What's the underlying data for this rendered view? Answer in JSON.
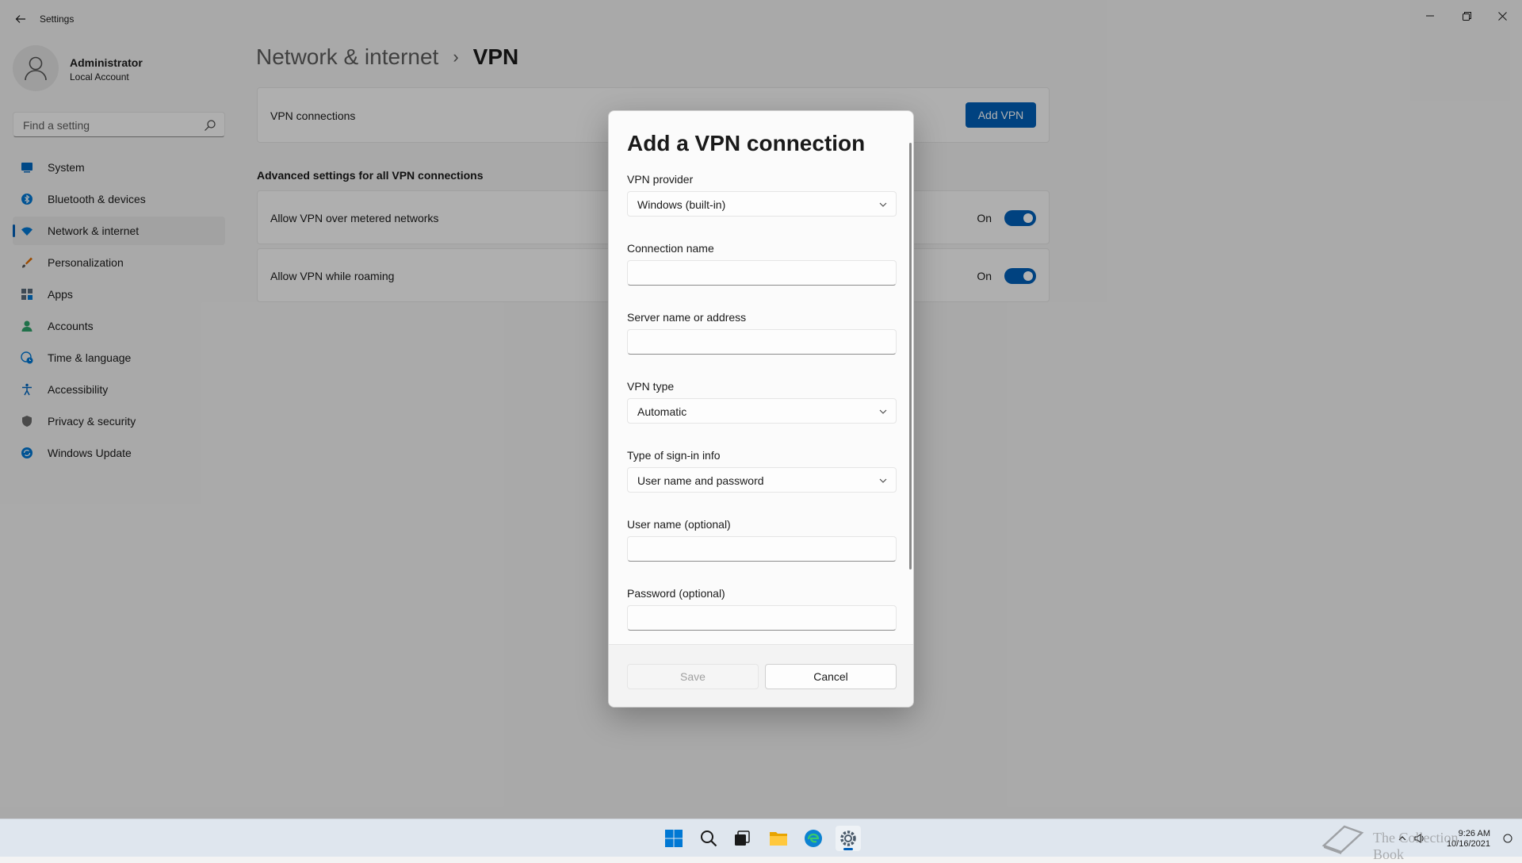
{
  "window": {
    "app_title": "Settings"
  },
  "profile": {
    "name": "Administrator",
    "account_type": "Local Account"
  },
  "search": {
    "placeholder": "Find a setting"
  },
  "sidebar": {
    "items": [
      {
        "label": "System",
        "icon": "system-icon",
        "color": "#0067c0"
      },
      {
        "label": "Bluetooth & devices",
        "icon": "bluetooth-icon",
        "color": "#0078d4"
      },
      {
        "label": "Network & internet",
        "icon": "wifi-icon",
        "color": "#0078d4",
        "selected": true
      },
      {
        "label": "Personalization",
        "icon": "brush-icon",
        "color": "#e06c00"
      },
      {
        "label": "Apps",
        "icon": "apps-icon",
        "color": "#5a6a7a"
      },
      {
        "label": "Accounts",
        "icon": "person-icon",
        "color": "#2ea36b"
      },
      {
        "label": "Time & language",
        "icon": "globe-clock-icon",
        "color": "#0078d4"
      },
      {
        "label": "Accessibility",
        "icon": "accessibility-icon",
        "color": "#0067c0"
      },
      {
        "label": "Privacy & security",
        "icon": "shield-icon",
        "color": "#6a6a6a"
      },
      {
        "label": "Windows Update",
        "icon": "update-icon",
        "color": "#0078d4"
      }
    ]
  },
  "header": {
    "breadcrumb_parent": "Network & internet",
    "separator": "›",
    "current": "VPN"
  },
  "vpn_connections": {
    "label": "VPN connections",
    "add_button": "Add VPN"
  },
  "advanced": {
    "title": "Advanced settings for all VPN connections",
    "settings": [
      {
        "label": "Allow VPN over metered networks",
        "state": "On"
      },
      {
        "label": "Allow VPN while roaming",
        "state": "On"
      }
    ]
  },
  "dialog": {
    "title": "Add a VPN connection",
    "vpn_provider": {
      "label": "VPN provider",
      "value": "Windows (built-in)"
    },
    "connection_name": {
      "label": "Connection name",
      "value": ""
    },
    "server": {
      "label": "Server name or address",
      "value": ""
    },
    "vpn_type": {
      "label": "VPN type",
      "value": "Automatic"
    },
    "signin_type": {
      "label": "Type of sign-in info",
      "value": "User name and password"
    },
    "username": {
      "label": "User name (optional)",
      "value": ""
    },
    "password": {
      "label": "Password (optional)",
      "value": ""
    },
    "save_label": "Save",
    "cancel_label": "Cancel"
  },
  "taskbar": {
    "apps": [
      "start-icon",
      "search-icon",
      "task-view-icon",
      "file-explorer-icon",
      "edge-icon",
      "settings-icon"
    ],
    "time": "9:26 AM",
    "date": "10/16/2021"
  },
  "watermark": {
    "text": "The Collection Book"
  },
  "colors": {
    "accent": "#005fb8",
    "background": "#f3f3f3",
    "card": "#fbfbfb"
  }
}
